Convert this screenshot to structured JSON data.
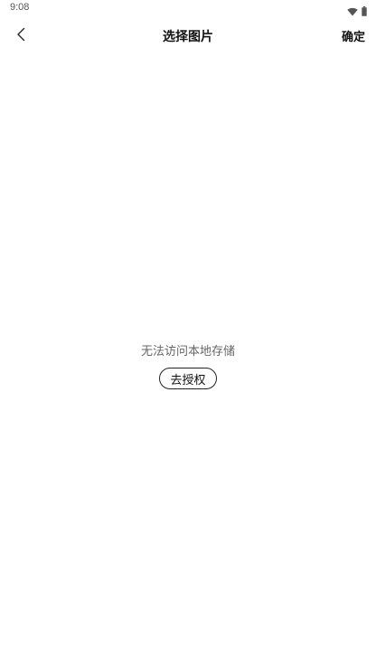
{
  "status_bar": {
    "time": "9:08",
    "icons": [
      "wifi-icon",
      "battery-icon"
    ]
  },
  "header": {
    "back_icon": "chevron-left-icon",
    "title": "选择图片",
    "confirm_label": "确定"
  },
  "empty_state": {
    "message": "无法访问本地存储",
    "button_label": "去授权"
  },
  "colors": {
    "background": "#ffffff",
    "text_primary": "#111111",
    "text_secondary": "#666666",
    "status_text": "#555555"
  }
}
